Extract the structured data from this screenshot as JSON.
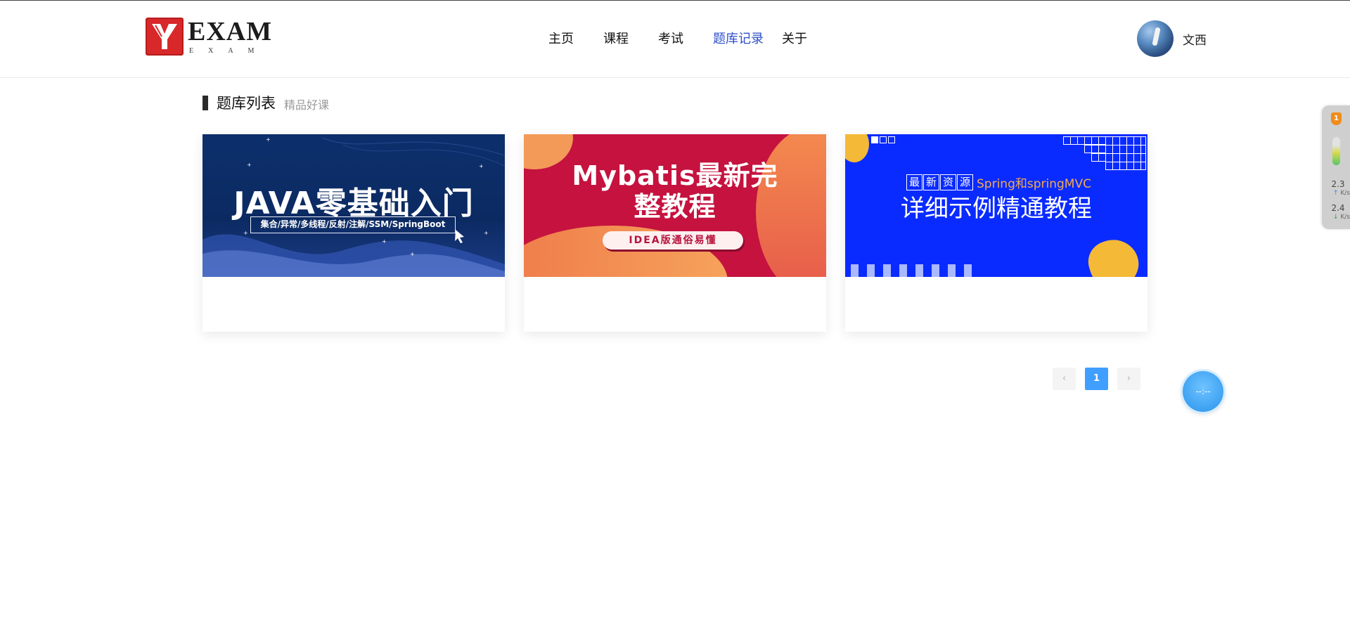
{
  "header": {
    "logo_text": "EXAM",
    "logo_sub": "EXAM",
    "nav": [
      {
        "label": "主页"
      },
      {
        "label": "课程"
      },
      {
        "label": "考试"
      },
      {
        "label": "题库记录"
      },
      {
        "label": "关于"
      }
    ],
    "active_nav": "题库记录",
    "user_name": "文西"
  },
  "section": {
    "title": "题库列表",
    "subtitle": "精品好课"
  },
  "cards": [
    {
      "headline": "JAVA零基础入门",
      "tagline": "集合/异常/多线程/反射/注解/SSM/SpringBoot"
    },
    {
      "headline_line1": "Mybatis最新完",
      "headline_line2": "整教程",
      "pill": "IDEA版通俗易懂"
    },
    {
      "box_chars": [
        "最",
        "新",
        "资",
        "源"
      ],
      "spring_text": "Spring和springMVC",
      "headline": "详细示例精通教程"
    }
  ],
  "pagination": {
    "prev": "‹",
    "current": "1",
    "next": "›"
  },
  "float_button": {
    "label": "--:--"
  },
  "side_widget": {
    "badge": "1",
    "up_value": "2.3",
    "up_unit": "K/s",
    "down_value": "2.4",
    "down_unit": "K/s"
  },
  "colors": {
    "active_nav": "#2d4ec9",
    "pagination_active": "#409eff",
    "logo_red": "#d8282a"
  }
}
